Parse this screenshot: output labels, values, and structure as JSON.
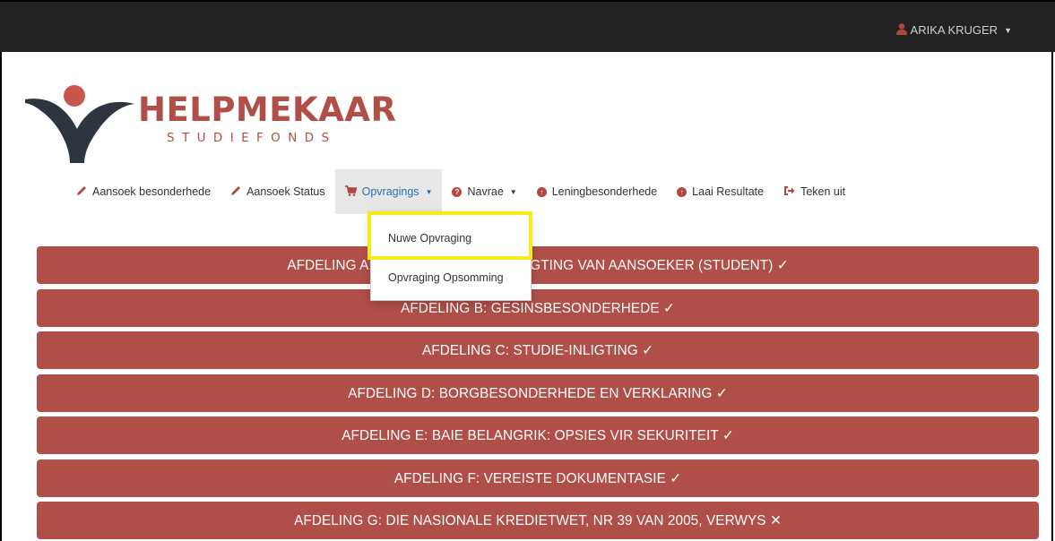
{
  "topbar": {
    "user_name": "ARIKA KRUGER",
    "user_icon": "user-icon",
    "caret_icon": "caret-down-icon"
  },
  "logo": {
    "word": "HELPMEKAAR",
    "subtitle": "STUDIEFONDS",
    "brand_color": "#b04f48",
    "dark_color": "#2e3440"
  },
  "nav": {
    "items": [
      {
        "label": "Aansoek besonderhede",
        "icon": "pencil-icon"
      },
      {
        "label": "Aansoek Status",
        "icon": "pencil-icon"
      },
      {
        "label": "Opvragings",
        "icon": "cart-icon"
      },
      {
        "label": "Navrae",
        "icon": "question-icon"
      },
      {
        "label": "Leningbesonderhede",
        "icon": "upload-circle-icon"
      },
      {
        "label": "Laai Resultate",
        "icon": "upload-circle-icon"
      },
      {
        "label": "Teken uit",
        "icon": "logout-icon"
      }
    ]
  },
  "dropdown": {
    "items": [
      {
        "label": "Nuwe Opvraging"
      },
      {
        "label": "Opvraging Opsomming"
      }
    ]
  },
  "sections": [
    {
      "label": "AFDELING A: BESONDERHEDE / INLIGTING VAN AANSOEKER (STUDENT) ✓",
      "status": "complete"
    },
    {
      "label": "AFDELING B: GESINSBESONDERHEDE ✓",
      "status": "complete"
    },
    {
      "label": "AFDELING C: STUDIE-INLIGTING ✓",
      "status": "complete"
    },
    {
      "label": "AFDELING D: BORGBESONDERHEDE EN VERKLARING ✓",
      "status": "complete"
    },
    {
      "label": "AFDELING E: BAIE BELANGRIK: OPSIES VIR SEKURITEIT ✓",
      "status": "complete"
    },
    {
      "label": "AFDELING F: VEREISTE DOKUMENTASIE ✓",
      "status": "complete"
    },
    {
      "label": "AFDELING G: DIE NASIONALE KREDIETWET, NR 39 VAN 2005, VERWYS ✕",
      "status": "incomplete"
    }
  ],
  "colors": {
    "topbar": "#222222",
    "section_bg": "#b04f48",
    "active_link": "#2d6fb0",
    "highlight": "#f7ec17"
  }
}
